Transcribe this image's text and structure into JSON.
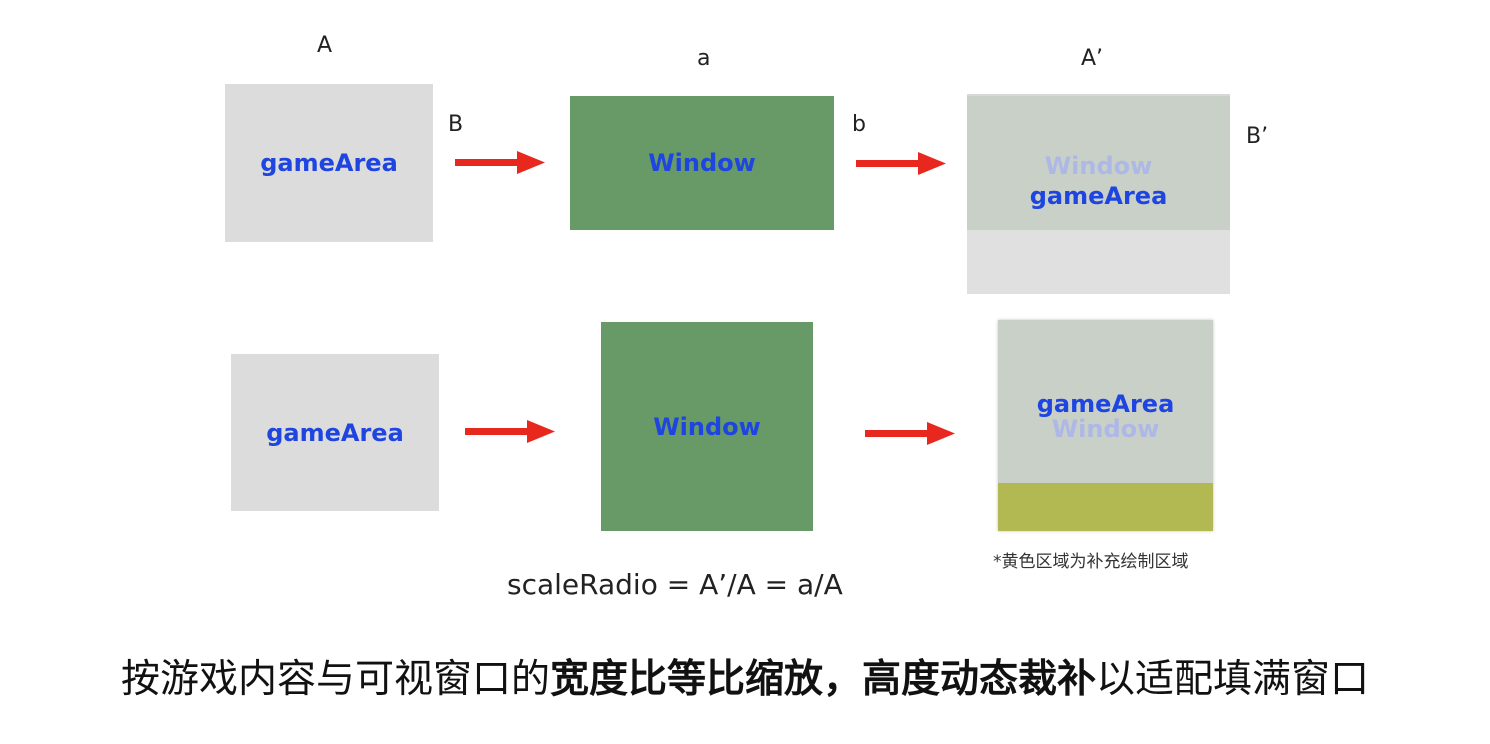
{
  "labels": {
    "A": "A",
    "a": "a",
    "A_prime": "A’",
    "B": "B",
    "b": "b",
    "B_prime": "B’"
  },
  "row1": {
    "game_area": "gameArea",
    "window": "Window",
    "result_window": "Window",
    "result_game_area": "gameArea"
  },
  "row2": {
    "game_area": "gameArea",
    "window": "Window",
    "result_game_area": "gameArea",
    "result_window": "Window"
  },
  "note": "*黄色区域为补充绘制区域",
  "formula": "scaleRadio = A’/A = a/A",
  "caption": {
    "part1": "按游戏内容与可视窗口的",
    "part2_bold": "宽度比等比缩放，高度动态裁补",
    "part3": "以适配填满窗口"
  },
  "colors": {
    "gray": "#dcdcdc",
    "green": "#679a66",
    "overlay_gray": "#c8d0c8",
    "light_gray": "#e0e0e0",
    "yellow": "#b3b952",
    "blue_text": "#1e45e0",
    "arrow_red": "#e8281e"
  }
}
